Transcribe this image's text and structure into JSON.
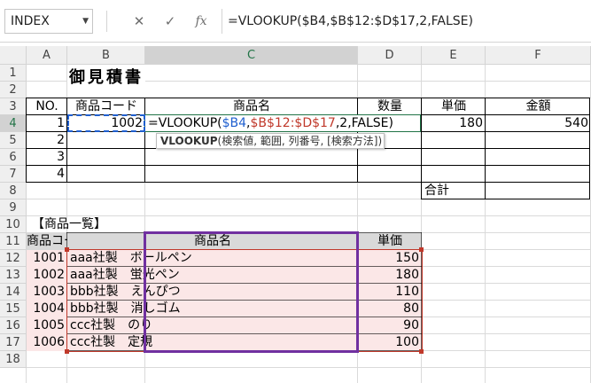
{
  "formula_bar": {
    "name_box": "INDEX",
    "cancel_icon": "✕",
    "enter_icon": "✓",
    "fx_label": "fx",
    "formula": "=VLOOKUP($B4,$B$12:$D$17,2,FALSE)"
  },
  "columns": [
    "A",
    "B",
    "C",
    "D",
    "E",
    "F"
  ],
  "rows": [
    "1",
    "2",
    "3",
    "4",
    "5",
    "6",
    "7",
    "8",
    "9",
    "10",
    "11",
    "12",
    "13",
    "14",
    "15",
    "16",
    "17",
    "18"
  ],
  "title": "御見積書",
  "quote_table": {
    "headers": [
      "NO.",
      "商品コード",
      "商品名",
      "数量",
      "単価",
      "金額"
    ],
    "rows": [
      {
        "no": "1",
        "code": "1002",
        "price": "180",
        "amount": "540"
      },
      {
        "no": "2",
        "code": "",
        "price": "",
        "amount": ""
      },
      {
        "no": "3",
        "code": "",
        "price": "",
        "amount": ""
      },
      {
        "no": "4",
        "code": "",
        "price": "",
        "amount": ""
      }
    ],
    "total_label": "合計"
  },
  "edit_cell": {
    "parts": [
      "=VLOOKUP(",
      "$B4",
      ",",
      "$B$12:$D$17",
      ",2,FALSE)"
    ],
    "ref1_color": "#1f5fcf",
    "ref2_color": "#c0392b"
  },
  "tooltip": {
    "fn": "VLOOKUP",
    "args": "(検索値, 範囲, 列番号, [検索方法])"
  },
  "product_list": {
    "label": "【商品一覧】",
    "headers": [
      "商品コード",
      "商品名",
      "単価"
    ],
    "rows": [
      {
        "code": "1001",
        "name": "aaa社製　ボールペン",
        "price": "150"
      },
      {
        "code": "1002",
        "name": "aaa社製　蛍光ペン",
        "price": "180"
      },
      {
        "code": "1003",
        "name": "bbb社製　えんぴつ",
        "price": "110"
      },
      {
        "code": "1004",
        "name": "bbb社製　消しゴム",
        "price": "80"
      },
      {
        "code": "1005",
        "name": "ccc社製　のり",
        "price": "90"
      },
      {
        "code": "1006",
        "name": "ccc社製　定規",
        "price": "100"
      }
    ]
  },
  "colors": {
    "range_fill": "#fbe7e7",
    "range_border": "#c0392b",
    "column_highlight": "#7030a0",
    "header_fill": "#d9d9d9",
    "active_cell": "#217346"
  }
}
